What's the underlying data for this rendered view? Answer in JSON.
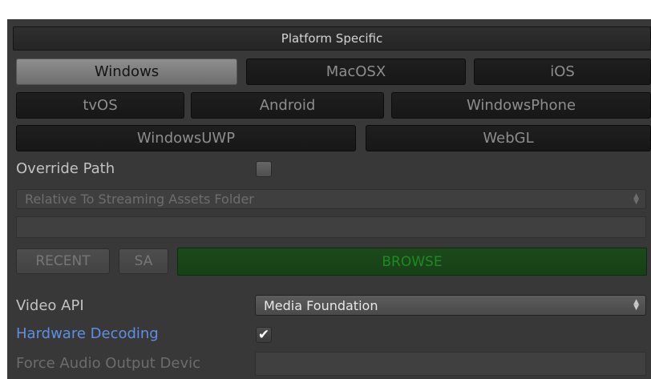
{
  "section": {
    "title": "Platform Specific"
  },
  "platforms": {
    "windows": "Windows",
    "macosx": "MacOSX",
    "ios": "iOS",
    "tvos": "tvOS",
    "android": "Android",
    "windowsphone": "WindowsPhone",
    "windowsuwp": "WindowsUWP",
    "webgl": "WebGL",
    "selected": "Windows"
  },
  "override_path": {
    "label": "Override Path",
    "checked": false
  },
  "path_mode": {
    "value": "Relative To Streaming Assets Folder"
  },
  "path_field": {
    "value": ""
  },
  "path_buttons": {
    "recent": "RECENT",
    "sa": "SA",
    "browse": "BROWSE"
  },
  "video_api": {
    "label": "Video API",
    "value": "Media Foundation"
  },
  "hardware_decoding": {
    "label": "Hardware Decoding",
    "checked": true,
    "check_glyph": "✔"
  },
  "force_audio_output": {
    "label": "Force Audio Output Devic",
    "value": ""
  },
  "colors": {
    "panel_bg": "#383838",
    "active_tab": "#7e7e7e",
    "browse_green": "#1f8a1f",
    "link_blue": "#5f8fe3"
  }
}
